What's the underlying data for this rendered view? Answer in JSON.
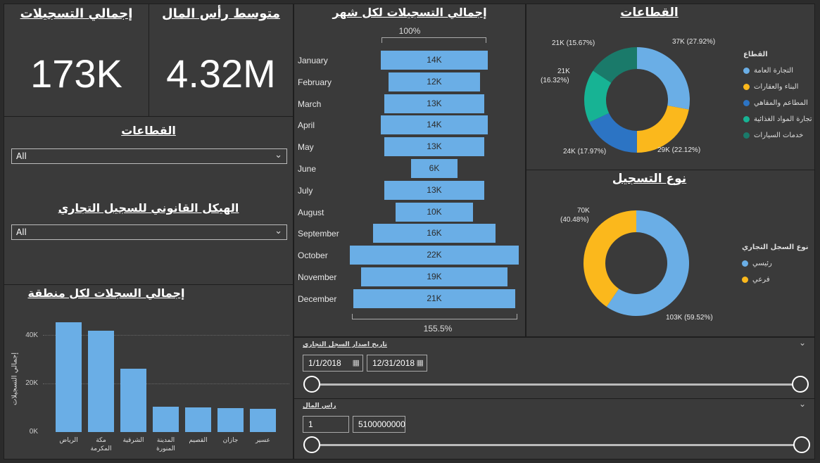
{
  "kpi": {
    "total_registrations": {
      "title": "إجمالي التسجيلات",
      "value": "173K"
    },
    "avg_capital": {
      "title": "متوسط رأس المال",
      "value": "4.32M"
    }
  },
  "filters": {
    "sectors": {
      "title": "القطاعات",
      "value": "All"
    },
    "legal_structure": {
      "title": "الهيكل القانوني للسجيل التجاري",
      "value": "All"
    }
  },
  "monthly": {
    "title": "إجمالي التسجيلات لكل شهر",
    "top_pct": "100%",
    "bottom_pct": "155.5%",
    "months": [
      {
        "label": "January",
        "value_label": "14K",
        "value": 14
      },
      {
        "label": "February",
        "value_label": "12K",
        "value": 12
      },
      {
        "label": "March",
        "value_label": "13K",
        "value": 13
      },
      {
        "label": "April",
        "value_label": "14K",
        "value": 14
      },
      {
        "label": "May",
        "value_label": "13K",
        "value": 13
      },
      {
        "label": "June",
        "value_label": "6K",
        "value": 6
      },
      {
        "label": "July",
        "value_label": "13K",
        "value": 13
      },
      {
        "label": "August",
        "value_label": "10K",
        "value": 10
      },
      {
        "label": "September",
        "value_label": "16K",
        "value": 16
      },
      {
        "label": "October",
        "value_label": "22K",
        "value": 22
      },
      {
        "label": "November",
        "value_label": "19K",
        "value": 19
      },
      {
        "label": "December",
        "value_label": "21K",
        "value": 21
      }
    ]
  },
  "sectors_donut": {
    "title": "القطاعات",
    "legend_title": "القطاع",
    "items": [
      {
        "name": "التجارة العامة",
        "label": "37K (27.92%)",
        "pct": 27.92,
        "color": "#6aaee6"
      },
      {
        "name": "البناء والعقارات",
        "label": "29K (22.12%)",
        "pct": 22.12,
        "color": "#fbb81c"
      },
      {
        "name": "المطاعم والمقاهي",
        "label": "24K (17.97%)",
        "pct": 17.97,
        "color": "#2c74c4"
      },
      {
        "name": "تجارة المواد الغذائية",
        "label": "21K (16.32%)",
        "pct": 16.32,
        "color": "#17b394"
      },
      {
        "name": "خدمات السيارات",
        "label": "21K (15.67%)",
        "pct": 15.67,
        "color": "#1a7a6a"
      }
    ],
    "label_4_line1": "21K",
    "label_4_line2": "(16.32%)"
  },
  "type_donut": {
    "title": "نوع التسجيل",
    "legend_title": "نوع السجل التجاري",
    "items": [
      {
        "name": "رئيسي",
        "label": "103K (59.52%)",
        "pct": 59.52,
        "color": "#6aaee6"
      },
      {
        "name": "فرعي",
        "label": "70K (40.48%)",
        "pct": 40.48,
        "color": "#fbb81c"
      }
    ],
    "label_2_line1": "70K",
    "label_2_line2": "(40.48%)"
  },
  "region": {
    "title": "إجمالي السجلات لكل منطقة",
    "ylabel": "إجمالي التسجيلات",
    "yticks": [
      "40K",
      "20K",
      "0K"
    ]
  },
  "chart_data": {
    "type": "bar",
    "title": "إجمالي السجلات لكل منطقة",
    "ylabel": "إجمالي التسجيلات",
    "categories": [
      "الرياض",
      "مكة المكرمة",
      "الشرقية",
      "المدينة المنورة",
      "القصيم",
      "جازان",
      "عسير"
    ],
    "category_lines": [
      [
        "الرياض"
      ],
      [
        "مكة",
        "المكرمة"
      ],
      [
        "الشرقية"
      ],
      [
        "المدينة",
        "المنورة"
      ],
      [
        "القصيم"
      ],
      [
        "جازان"
      ],
      [
        "عسير"
      ]
    ],
    "values": [
      45000,
      41500,
      26000,
      10500,
      10200,
      9700,
      9600
    ],
    "ylim": [
      0,
      50000
    ],
    "grid": true
  },
  "date_slicer": {
    "title": "تاريخ اصدار السجل التجاري",
    "start": "1/1/2018",
    "end": "12/31/2018",
    "calendar_icon": "▦",
    "collapse_icon": "⌄"
  },
  "capital_slicer": {
    "title": "راس المال",
    "min": "1",
    "max": "5100000000",
    "collapse_icon": "⌄"
  },
  "colors": {
    "background": "#2b2b2b",
    "panel": "#3a3a3a",
    "bar": "#6aaee6",
    "accent_yellow": "#fbb81c"
  }
}
